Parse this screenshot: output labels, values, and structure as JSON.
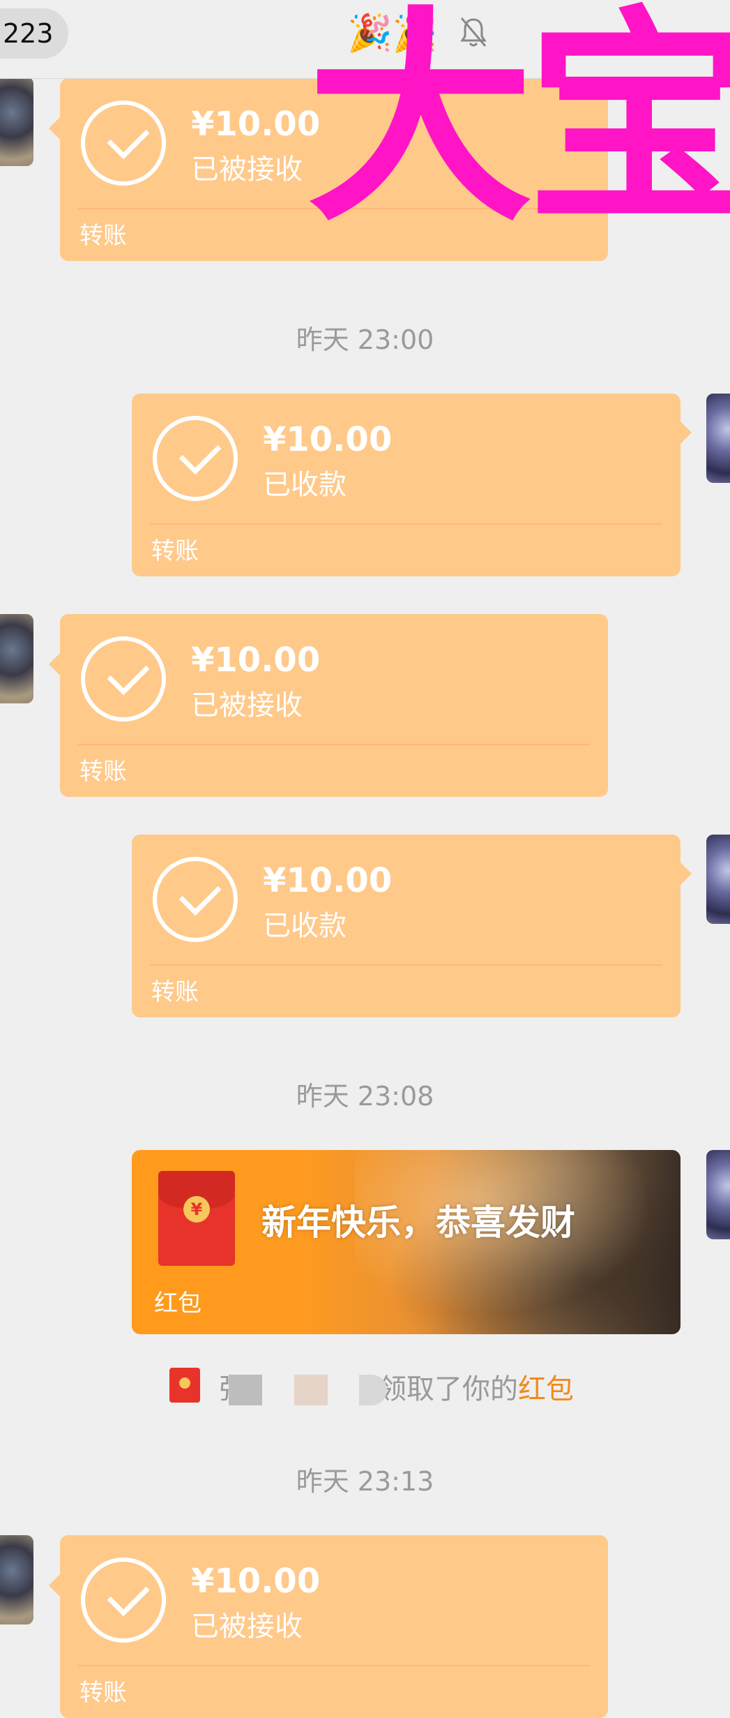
{
  "header": {
    "unread_count": "223",
    "overlay_text": "大宝",
    "party_emoji": "🎉🎉",
    "mute_icon": "bell-muted-icon"
  },
  "colors": {
    "transfer_card": "#FFC98A",
    "overlay": "#FF14C6",
    "red_packet_link": "#F08A1C",
    "background": "#EFEFEF"
  },
  "messages": [
    {
      "type": "transfer",
      "side": "left",
      "amount": "¥10.00",
      "status": "已被接收",
      "label": "转账"
    },
    {
      "type": "time",
      "text": "昨天 23:00"
    },
    {
      "type": "transfer",
      "side": "right",
      "amount": "¥10.00",
      "status": "已收款",
      "label": "转账"
    },
    {
      "type": "transfer",
      "side": "left",
      "amount": "¥10.00",
      "status": "已被接收",
      "label": "转账"
    },
    {
      "type": "transfer",
      "side": "right",
      "amount": "¥10.00",
      "status": "已收款",
      "label": "转账"
    },
    {
      "type": "time",
      "text": "昨天 23:08"
    },
    {
      "type": "red_packet",
      "side": "right",
      "greeting": "新年快乐，恭喜发财",
      "label": "红包"
    },
    {
      "type": "system",
      "text_start": "张",
      "text_end": "领取了你的",
      "link": "红包"
    },
    {
      "type": "time",
      "text": "昨天 23:13"
    },
    {
      "type": "transfer",
      "side": "left",
      "amount": "¥10.00",
      "status": "已被接收",
      "label": "转账"
    }
  ]
}
